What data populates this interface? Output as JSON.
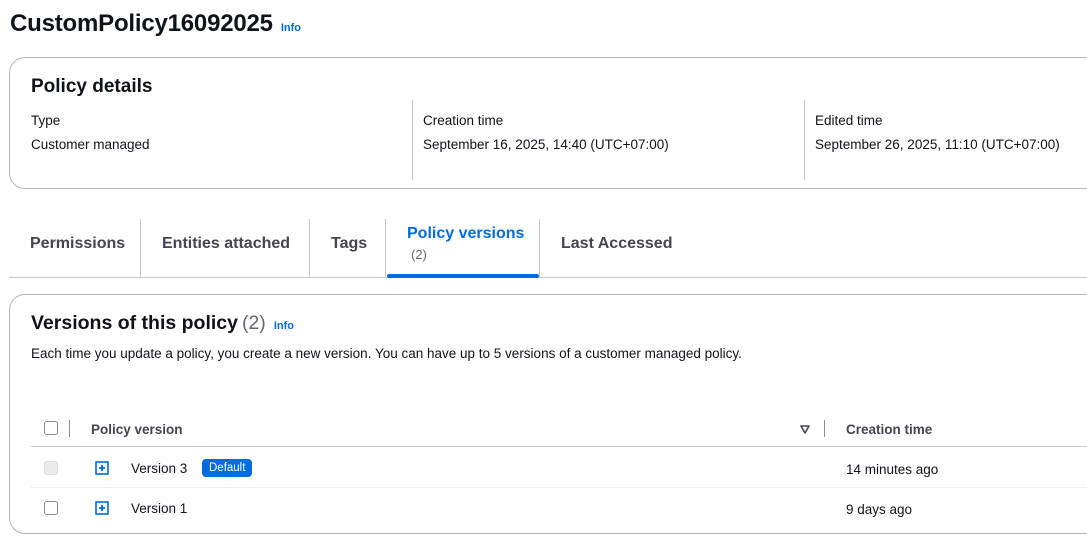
{
  "header": {
    "title": "CustomPolicy16092025",
    "info_label": "Info"
  },
  "details": {
    "title": "Policy details",
    "type_label": "Type",
    "type_value": "Customer managed",
    "creation_label": "Creation time",
    "creation_value": "September 16, 2025, 14:40 (UTC+07:00)",
    "edited_label": "Edited time",
    "edited_value": "September 26, 2025, 11:10 (UTC+07:00)"
  },
  "tabs": [
    {
      "label": "Permissions"
    },
    {
      "label": "Entities attached"
    },
    {
      "label": "Tags"
    },
    {
      "label": "Policy versions",
      "count": "(2)"
    },
    {
      "label": "Last Accessed"
    }
  ],
  "versions": {
    "title": "Versions of this policy",
    "count": "(2)",
    "info_label": "Info",
    "description": "Each time you update a policy, you create a new version. You can have up to 5 versions of a customer managed policy.",
    "columns": {
      "version": "Policy version",
      "creation": "Creation time"
    },
    "rows": [
      {
        "version": "Version 3",
        "badge": "Default",
        "creation": "14 minutes ago"
      },
      {
        "version": "Version 1",
        "badge": "",
        "creation": "9 days ago"
      }
    ]
  },
  "colors": {
    "accent": "#006ce0",
    "text": "#0f141a",
    "border": "#b4b4bb"
  },
  "icons": [
    "expand-icon",
    "sort-descending-icon",
    "checkbox"
  ]
}
